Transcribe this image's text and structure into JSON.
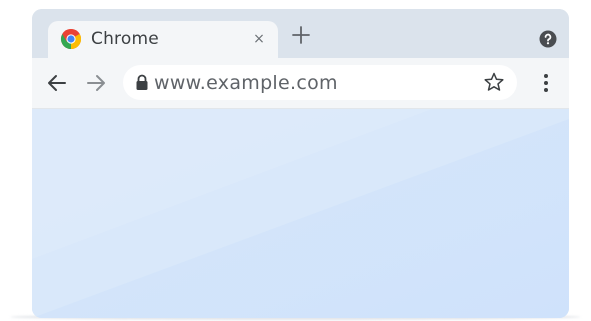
{
  "browser": {
    "name": "Chrome"
  },
  "tab": {
    "title": "Chrome",
    "close_label": "×"
  },
  "toolbar": {
    "url": "www.example.com"
  },
  "icons": {
    "favicon": "chrome-logo-icon",
    "close": "close-icon",
    "new_tab": "plus-icon",
    "help": "help-icon",
    "back": "arrow-left-icon",
    "forward": "arrow-right-icon",
    "lock": "lock-icon",
    "bookmark": "star-icon",
    "menu": "more-vertical-icon"
  },
  "colors": {
    "tabstrip": "#dbe3ec",
    "toolbar": "#f4f6f8",
    "content": "#d6e6fb",
    "text": "#3c4043"
  }
}
